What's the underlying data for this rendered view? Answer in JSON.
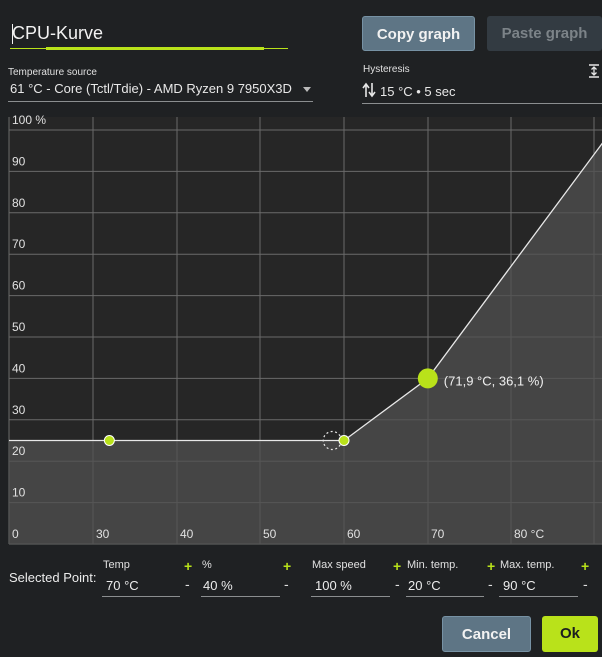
{
  "title_value": "CPU-Kurve",
  "buttons": {
    "copy_graph": "Copy graph",
    "paste_graph": "Paste graph",
    "cancel": "Cancel",
    "ok": "Ok"
  },
  "temperature_source": {
    "label": "Temperature source",
    "value": "61 °C - Core (Tctl/Tdie) - AMD Ryzen 9 7950X3D"
  },
  "hysteresis": {
    "label": "Hysteresis",
    "value": "15 °C • 5 sec"
  },
  "chart_data": {
    "type": "area",
    "x_tick_labels": [
      "0",
      "30",
      "40",
      "50",
      "60",
      "70",
      "80 °C"
    ],
    "y_tick_labels": [
      "100 %",
      "90",
      "80",
      "70",
      "60",
      "50",
      "40",
      "30",
      "20",
      "10"
    ],
    "xlim": [
      20,
      92
    ],
    "ylim": [
      0,
      100
    ],
    "points": [
      {
        "x": 32,
        "y": 25
      },
      {
        "x": 60,
        "y": 25
      },
      {
        "x": 70,
        "y": 40
      },
      {
        "x": 92,
        "y": 100
      }
    ],
    "hysteresis_marker": {
      "x": 58.6,
      "y": 25
    },
    "annotation": "(71,9 °C, 36,1 %)",
    "colors": {
      "line": "#e8e8e8",
      "point": "#b9e21a",
      "fill": "#505050",
      "grid": "#6a6a6a"
    }
  },
  "selected_point": {
    "label": "Selected Point:",
    "fields": [
      {
        "label": "Temp",
        "value": "70 °C"
      },
      {
        "label": "%",
        "value": "40 %"
      },
      {
        "label": "Max speed",
        "value": "100 %"
      },
      {
        "label": "Min. temp.",
        "value": "20 °C"
      },
      {
        "label": "Max. temp.",
        "value": "90 °C"
      }
    ],
    "plus": "+",
    "minus": "-"
  },
  "icons": {
    "hysteresis": "up-down-arrows-icon",
    "expand": "expand-vertical-icon",
    "dropdown": "chevron-down-icon"
  }
}
